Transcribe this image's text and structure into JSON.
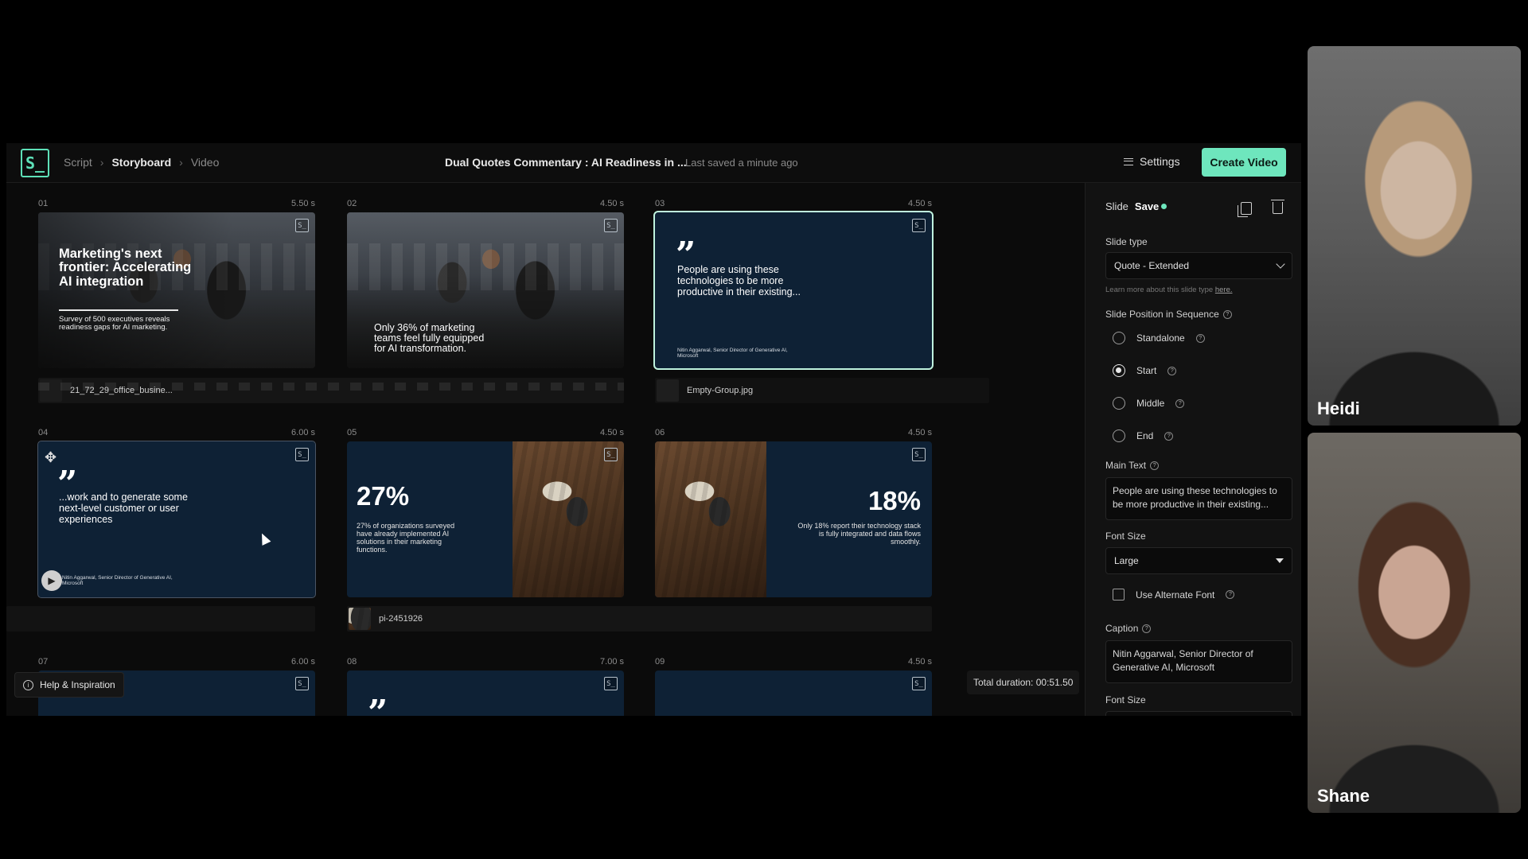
{
  "app": {
    "logo_text": "S_",
    "breadcrumbs": [
      "Script",
      "Storyboard",
      "Video"
    ],
    "active_crumb": "Storyboard",
    "doc_title": "Dual Quotes Commentary : AI Readiness in ...",
    "saved_status": "Last saved a minute ago",
    "settings_label": "Settings",
    "create_label": "Create Video"
  },
  "slides": [
    {
      "num": "01",
      "duration": "5.50 s",
      "title": "Marketing's next frontier: Accelerating AI integration",
      "subtitle": "Survey of 500 executives reveals readiness gaps for AI marketing.",
      "asset": "21_72_29_office_busine..."
    },
    {
      "num": "02",
      "duration": "4.50 s",
      "text": "Only 36% of marketing teams feel fully equipped for AI transformation."
    },
    {
      "num": "03",
      "duration": "4.50 s",
      "quote": "People are using these technologies to be more productive in their existing...",
      "caption": "Nitin Aggarwal, Senior Director of Generative AI, Microsoft",
      "asset": "Empty-Group.jpg"
    },
    {
      "num": "04",
      "duration": "6.00 s",
      "quote": "...work and to generate some next-level customer or user experiences",
      "caption": "Nitin Aggarwal, Senior Director of Generative AI, Microsoft"
    },
    {
      "num": "05",
      "duration": "4.50 s",
      "stat": "27%",
      "stat_text": "27% of organizations surveyed have already implemented AI solutions in their marketing functions.",
      "asset": "pi-2451926"
    },
    {
      "num": "06",
      "duration": "4.50 s",
      "stat": "18%",
      "stat_text": "Only 18% report their technology stack is fully integrated and data flows smoothly."
    },
    {
      "num": "07",
      "duration": "6.00 s"
    },
    {
      "num": "08",
      "duration": "7.00 s"
    },
    {
      "num": "09",
      "duration": "4.50 s"
    }
  ],
  "quote_glyph": "”",
  "total_duration": "Total duration: 00:51.50",
  "help_label": "Help & Inspiration",
  "panel": {
    "title": "Slide",
    "save_label": "Save",
    "slide_type_label": "Slide type",
    "slide_type_value": "Quote - Extended",
    "learn_more_prefix": "Learn more about this slide type ",
    "learn_more_link": "here.",
    "position_label": "Slide Position in Sequence",
    "positions": [
      "Standalone",
      "Start",
      "Middle",
      "End"
    ],
    "selected_position": "Start",
    "main_text_label": "Main Text",
    "main_text_value": "People are using these technologies to be more productive in their existing...",
    "font_size_label": "Font Size",
    "font_size_value": "Large",
    "alt_font_label": "Use Alternate Font",
    "caption_label": "Caption",
    "caption_value": "Nitin Aggarwal, Senior Director of Generative AI, Microsoft",
    "font_size_label_2": "Font Size"
  },
  "participants": [
    {
      "name": "Heidi"
    },
    {
      "name": "Shane"
    }
  ],
  "colors": {
    "accent": "#6ee6bd",
    "slide_bg": "#0e2135"
  }
}
